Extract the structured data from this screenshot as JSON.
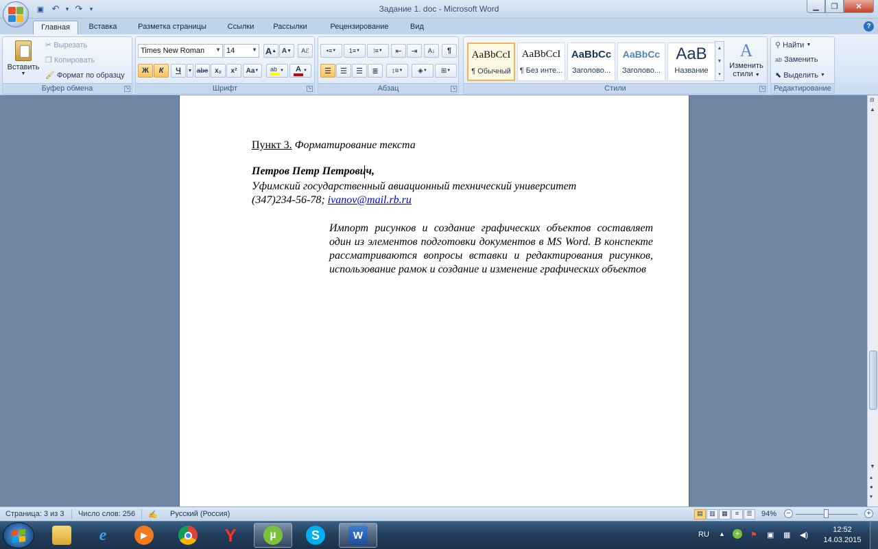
{
  "window": {
    "title": "Задание 1. doc - Microsoft Word",
    "controls": {
      "minimize": "▁",
      "maximize": "❐",
      "close": "✕"
    }
  },
  "qat": {
    "save": "💾",
    "undo": "↶",
    "redo": "↷",
    "more": "▾"
  },
  "tabs": [
    "Главная",
    "Вставка",
    "Разметка страницы",
    "Ссылки",
    "Рассылки",
    "Рецензирование",
    "Вид"
  ],
  "help": "?",
  "clipboard": {
    "paste": "Вставить",
    "cut": "Вырезать",
    "copy": "Копировать",
    "format_painter": "Формат по образцу",
    "label": "Буфер обмена"
  },
  "font": {
    "name": "Times New Roman",
    "size": "14",
    "grow": "A",
    "shrink": "A",
    "bold": "Ж",
    "italic": "К",
    "underline": "Ч",
    "strike": "abe",
    "subscript": "x₂",
    "superscript": "x²",
    "case": "Aa",
    "label": "Шрифт"
  },
  "paragraph": {
    "label": "Абзац",
    "pilcrow": "¶"
  },
  "styles": {
    "tiles": [
      {
        "sample": "AaBbCcI",
        "name": "¶ Обычный"
      },
      {
        "sample": "AaBbCcI",
        "name": "¶ Без инте..."
      },
      {
        "sample": "AaBbCc",
        "name": "Заголово..."
      },
      {
        "sample": "AaBbCc",
        "name": "Заголово..."
      },
      {
        "sample": "AaB",
        "name": "Название"
      }
    ],
    "change": "Изменить",
    "change2": "стили",
    "label": "Стили"
  },
  "editing": {
    "find": "Найти",
    "replace": "Заменить",
    "select": "Выделить",
    "label": "Редактирование"
  },
  "document": {
    "heading_label": "Пункт 3.",
    "heading_text": " Форматирование текста",
    "author": "Петров Петр Петрович,",
    "university": "Уфимский государственный авиационный технический университет",
    "phone": "(347)234-56-78; ",
    "email": "ivanov@mail.rb.ru",
    "abstract": "Импорт рисунков и создание графических объектов составляет один из элементов подготовки документов в MS Word. В конспекте рассматриваются вопросы вставки и редактирования рисунков, использование рамок и создание и изменение графических объектов"
  },
  "status": {
    "page": "Страница: 3 из 3",
    "words": "Число слов: 256",
    "language": "Русский (Россия)",
    "zoom": "94%",
    "zoom_level": 0.94
  },
  "taskbar": {
    "lang": "RU",
    "time": "12:52",
    "date": "14.03.2015",
    "apps": [
      "explorer",
      "internet-explorer",
      "media-player",
      "chrome",
      "yandex",
      "utorrent",
      "skype",
      "word"
    ]
  }
}
